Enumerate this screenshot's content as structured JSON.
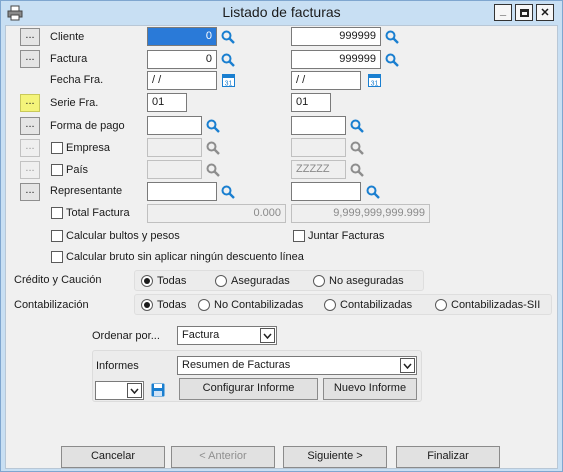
{
  "window": {
    "title": "Listado de facturas",
    "min_glyph": "_",
    "max_glyph": "□",
    "close_glyph": "✕"
  },
  "accent_color": "#2a7ad8",
  "dots_label": "...",
  "fields": {
    "cliente": {
      "label": "Cliente",
      "from": "0",
      "to": "999999"
    },
    "factura": {
      "label": "Factura",
      "from": "0",
      "to": "999999"
    },
    "fecha": {
      "label": "Fecha Fra.",
      "from": " / /",
      "to": " / /",
      "cal_text": "31"
    },
    "serie": {
      "label": "Serie Fra.",
      "from": "01",
      "to": "01"
    },
    "forma_pago": {
      "label": "Forma de pago",
      "from": "",
      "to": ""
    },
    "empresa": {
      "label": "Empresa",
      "from": "",
      "to": ""
    },
    "pais": {
      "label": "País",
      "from": "",
      "to": "ZZZZZ"
    },
    "representante": {
      "label": "Representante",
      "from": "",
      "to": ""
    },
    "total": {
      "label": "Total Factura",
      "from": "0.000",
      "to": "9,999,999,999.999"
    }
  },
  "options": {
    "calcular_bultos": "Calcular bultos y pesos",
    "juntar_facturas": "Juntar Facturas",
    "calcular_bruto": "Calcular bruto sin aplicar ningún descuento línea"
  },
  "credito": {
    "label": "Crédito y Caución",
    "options": [
      "Todas",
      "Aseguradas",
      "No aseguradas"
    ],
    "selected": "Todas"
  },
  "contabilizacion": {
    "label": "Contabilización",
    "options": [
      "Todas",
      "No Contabilizadas",
      "Contabilizadas",
      "Contabilizadas-SII"
    ],
    "selected": "Todas"
  },
  "ordenar": {
    "label": "Ordenar por...",
    "value": "Factura"
  },
  "informes": {
    "label": "Informes",
    "value": "Resumen de Facturas",
    "small_select": "",
    "configurar": "Configurar Informe",
    "nuevo": "Nuevo Informe"
  },
  "footer": {
    "cancelar": "Cancelar",
    "anterior": "< Anterior",
    "siguiente": "Siguiente >",
    "finalizar": "Finalizar"
  }
}
